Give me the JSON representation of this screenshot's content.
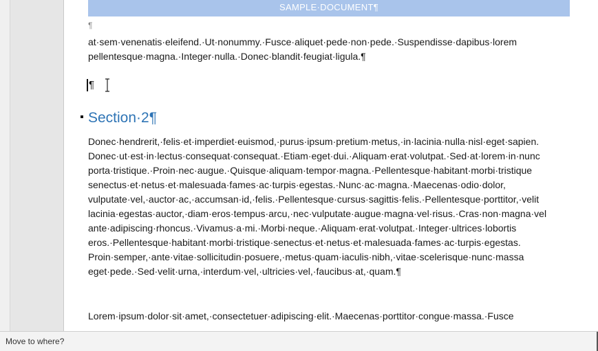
{
  "document": {
    "header_text": "SAMPLE·DOCUMENT¶",
    "empty_mark": "¶",
    "para1_line1": "at·sem·venenatis·eleifend.·Ut·nonummy.·Fusce·aliquet·pede·non·pede.·Suspendisse·dapibus·lorem",
    "para1_line2": "pellentesque·magna.·Integer·nulla.·Donec·blandit·feugiat·ligula.¶",
    "cursor_line": "¶",
    "section_heading": "Section·2¶",
    "section_lines": [
      "Donec·hendrerit,·felis·et·imperdiet·euismod,·purus·ipsum·pretium·metus,·in·lacinia·nulla·nisl·eget·sapien.",
      "Donec·ut·est·in·lectus·consequat·consequat.·Etiam·eget·dui.·Aliquam·erat·volutpat.·Sed·at·lorem·in·nunc",
      "porta·tristique.·Proin·nec·augue.·Quisque·aliquam·tempor·magna.·Pellentesque·habitant·morbi·tristique",
      "senectus·et·netus·et·malesuada·fames·ac·turpis·egestas.·Nunc·ac·magna.·Maecenas·odio·dolor,",
      "vulputate·vel,·auctor·ac,·accumsan·id,·felis.·Pellentesque·cursus·sagittis·felis.·Pellentesque·porttitor,·velit",
      "lacinia·egestas·auctor,·diam·eros·tempus·arcu,·nec·vulputate·augue·magna·vel·risus.·Cras·non·magna·vel",
      "ante·adipiscing·rhoncus.·Vivamus·a·mi.·Morbi·neque.·Aliquam·erat·volutpat.·Integer·ultrices·lobortis",
      "eros.·Pellentesque·habitant·morbi·tristique·senectus·et·netus·et·malesuada·fames·ac·turpis·egestas.",
      "Proin·semper,·ante·vitae·sollicitudin·posuere,·metus·quam·iaculis·nibh,·vitae·scelerisque·nunc·massa",
      "eget·pede.·Sed·velit·urna,·interdum·vel,·ultricies·vel,·faucibus·at,·quam.¶"
    ],
    "para3_line1": "Lorem·ipsum·dolor·sit·amet,·consectetuer·adipiscing·elit.·Maecenas·porttitor·congue·massa.·Fusce"
  },
  "status_bar": {
    "text": "Move to where?"
  },
  "colors": {
    "heading": "#2e74b5",
    "header_band": "#a9c4eb"
  }
}
